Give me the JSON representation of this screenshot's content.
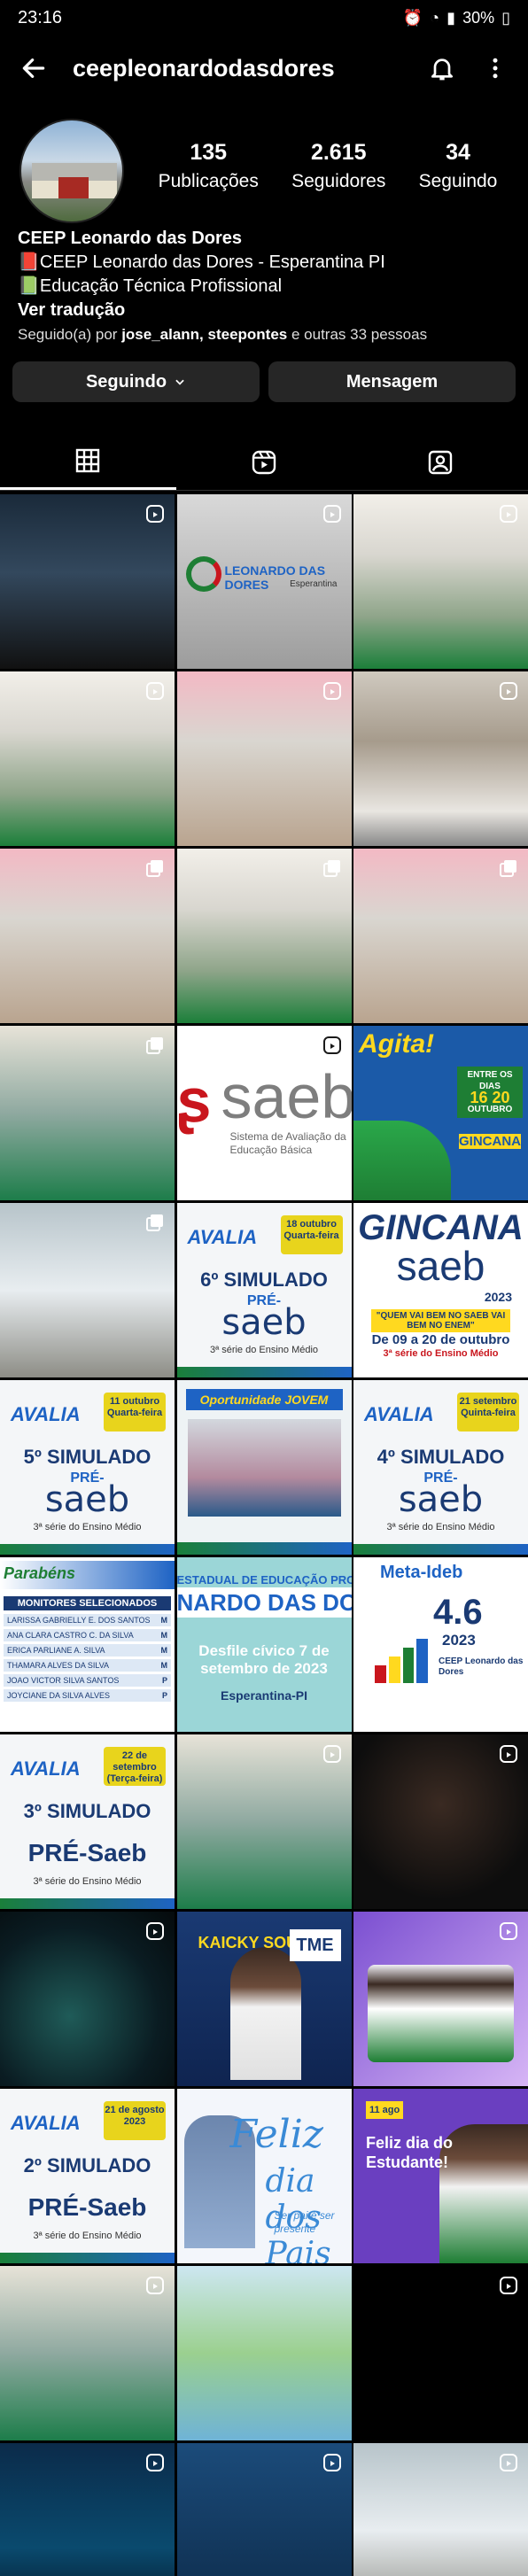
{
  "status_bar": {
    "time": "23:16",
    "battery": "30%",
    "icons": [
      "alarm-icon",
      "wifi-icon",
      "signal-icon",
      "battery-icon"
    ]
  },
  "header": {
    "username": "ceepleonardodasdores",
    "back_icon": "arrow-left-icon",
    "notify_icon": "bell-icon",
    "more_icon": "more-vertical-icon"
  },
  "profile": {
    "stats": [
      {
        "value": "135",
        "label": "Publicações"
      },
      {
        "value": "2.615",
        "label": "Seguidores"
      },
      {
        "value": "34",
        "label": "Seguindo"
      }
    ],
    "name": "CEEP Leonardo das Dores",
    "bio_line1": "📕CEEP Leonardo das Dores - Esperantina PI",
    "bio_line2": "📗Educação Técnica Profissional",
    "translate": "Ver tradução",
    "followed_prefix": "Seguido(a) por ",
    "followed_names": "jose_alann, steepontes",
    "followed_suffix": " e outras 33 pessoas"
  },
  "actions": {
    "following": "Seguindo",
    "message": "Mensagem"
  },
  "tabs": [
    {
      "name": "grid-icon",
      "active": true
    },
    {
      "name": "reels-icon",
      "active": false
    },
    {
      "name": "tagged-icon",
      "active": false
    }
  ],
  "posts": {
    "logo_text": "LEONARDO DAS DORES",
    "logo_city": "Esperantina",
    "saeb_word": "saeb",
    "saeb_sub1": "Sistema de Avaliação da",
    "saeb_sub2": "Educação Básica",
    "agita_title": "Agita!",
    "agita_line1": "ENTRE OS DIAS",
    "agita_days": "16 20",
    "agita_month": "OUTUBRO",
    "agita_gincana": "GINCANA",
    "gincana_title": "GINCANA",
    "gincana_saeb": "saeb",
    "gincana_year": "2023",
    "gincana_quote": "\"QUEM VAI BEM NO SAEB VAI BEM NO ENEM\"",
    "gincana_dates": "De 09 a 20 de outubro",
    "gincana_serie": "3ª série do Ensino Médio",
    "avalia": "AVALIA",
    "pre": "PRÉ-",
    "saeb": "saeb",
    "pre_saeb": "PRÉ-Saeb",
    "serie": "3ª série do Ensino Médio",
    "sim6": "6º SIMULADO",
    "sim6_date": "18 outubro Quarta-feira",
    "sim5": "5º SIMULADO",
    "sim5_date": "11 outubro Quarta-feira",
    "sim4": "4º SIMULADO",
    "sim4_date": "21 setembro Quinta-feira",
    "sim3": "3º SIMULADO",
    "sim3_date": "22 de setembro (Terça-feira)",
    "sim2": "2º SIMULADO",
    "sim2_date": "21 de agosto 2023",
    "oportunidade": "Oportunidade JOVEM",
    "monitors_title": "Parabéns",
    "monitors_head": "MONITORES SELECIONADOS",
    "monitors": [
      {
        "name": "LARISSA GABRIELLY E. DOS SANTOS",
        "tag": "M"
      },
      {
        "name": "ANA CLARA CASTRO C. DA SILVA",
        "tag": "M"
      },
      {
        "name": "ERICA PARLIANE A. SILVA",
        "tag": "M"
      },
      {
        "name": "THAMARA ALVES DA SILVA",
        "tag": "M"
      },
      {
        "name": "JOAO VICTOR SILVA SANTOS",
        "tag": "P"
      },
      {
        "name": "JOYCIANE DA SILVA ALVES",
        "tag": "P"
      }
    ],
    "desfile_top": "ESTADUAL DE EDUCAÇÃO PROFI",
    "desfile_name": "NARDO DAS DO",
    "desfile_text": "Desfile cívico 7 de setembro de 2023",
    "desfile_loc": "Esperantina-PI",
    "ideb_meta": "Meta-Ideb",
    "ideb_value": "4.6",
    "ideb_year": "2023",
    "ideb_school": "CEEP Leonardo das Dores",
    "tme_name": "KAICKY SOUZA",
    "tme_logo": "TME",
    "pais_feliz": "Feliz",
    "pais_dia": "dia dos Pais",
    "pais_sub": "Ser pai é ser presente",
    "estud_tag": "11 ago",
    "estud_title": "Feliz dia do Estudante!"
  }
}
